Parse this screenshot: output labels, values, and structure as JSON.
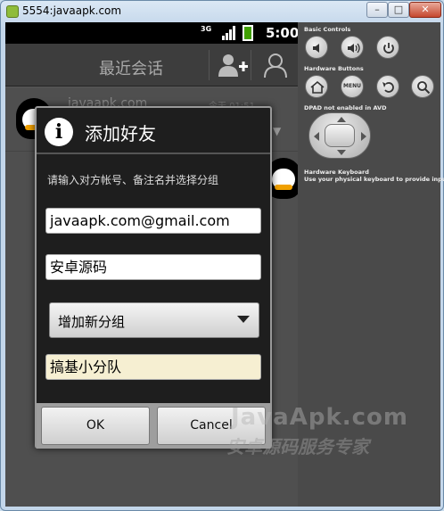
{
  "window": {
    "title": "5554:javaapk.com",
    "min_glyph": "–",
    "max_glyph": "□",
    "close_glyph": "✕"
  },
  "statusbar": {
    "network": "3G",
    "time": "5:00"
  },
  "app": {
    "title": "最近会话"
  },
  "list": [
    {
      "name": "javaapk.com",
      "time": "今天 01:51"
    }
  ],
  "dialog": {
    "title": "添加好友",
    "message": "请输入对方帐号、备注名并选择分组",
    "account_value": "javaapk.com@gmail.com",
    "remark_value": "安卓源码",
    "group_select": "增加新分组",
    "new_group_value": "搞基小分队",
    "ok_label": "OK",
    "cancel_label": "Cancel"
  },
  "controls": {
    "basic_label": "Basic Controls",
    "hardware_buttons_label": "Hardware Buttons",
    "menu_label": "MENU",
    "dpad_label": "DPAD not enabled in AVD",
    "keyboard_label": "Hardware Keyboard",
    "keyboard_hint": "Use your physical keyboard to provide input"
  },
  "watermark": {
    "line1": "JavaApk.com",
    "line2": "安卓源码服务专家"
  }
}
